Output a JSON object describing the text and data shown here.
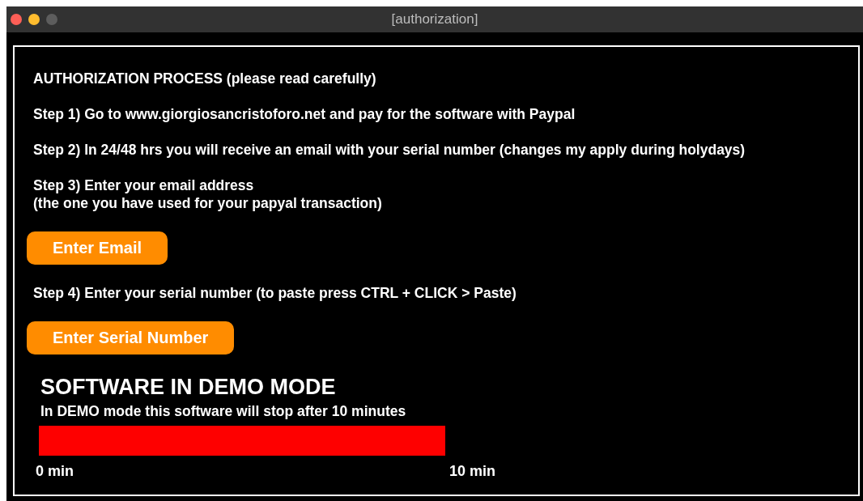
{
  "window": {
    "title": "[authorization]"
  },
  "steps": [
    {
      "kind": "text",
      "text": "AUTHORIZATION PROCESS (please read carefully)"
    },
    {
      "kind": "text",
      "text": "Step 1) Go to www.giorgiosancristoforo.net and pay for the software with Paypal"
    },
    {
      "kind": "text",
      "text": "Step 2)  In 24/48 hrs you will receive an email with your serial number (changes my apply during holydays)"
    },
    {
      "kind": "text",
      "text": "Step 3) Enter your email address\n(the one you have used for your papyal transaction)"
    },
    {
      "kind": "button",
      "text": "Enter Email"
    },
    {
      "kind": "text",
      "text": "Step 4) Enter your serial number (to paste press CTRL + CLICK > Paste)"
    },
    {
      "kind": "button",
      "text": "Enter Serial Number"
    }
  ],
  "demo": {
    "title": "SOFTWARE IN DEMO MODE",
    "note": "In DEMO mode this software will stop after 10 minutes",
    "level": 1,
    "start_label": "0 min",
    "end_label": "10 min"
  }
}
